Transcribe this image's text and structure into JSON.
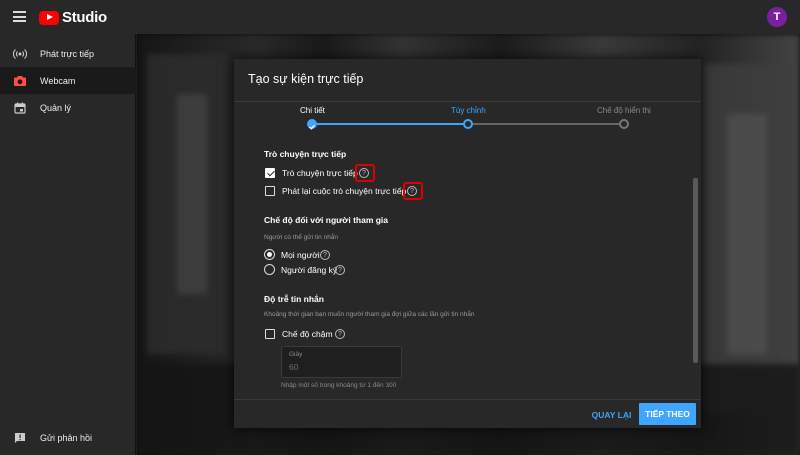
{
  "header": {
    "app_name": "Studio",
    "avatar_letter": "T"
  },
  "sidebar": {
    "items": [
      {
        "label": "Phát trực tiếp",
        "icon": "broadcast-icon"
      },
      {
        "label": "Webcam",
        "icon": "camera-icon",
        "active": true
      },
      {
        "label": "Quản lý",
        "icon": "calendar-icon"
      }
    ],
    "feedback_label": "Gửi phản hồi"
  },
  "dialog": {
    "title": "Tạo sự kiện trực tiếp",
    "steps": [
      {
        "label": "Chi tiết",
        "state": "completed"
      },
      {
        "label": "Tùy chỉnh",
        "state": "current"
      },
      {
        "label": "Chế độ hiển thị",
        "state": "pending"
      }
    ],
    "live_chat": {
      "title": "Trò chuyện trực tiếp",
      "chat_option": {
        "label": "Trò chuyện trực tiếp",
        "checked": true
      },
      "replay_option": {
        "label": "Phát lại cuộc trò chuyện trực tiếp",
        "checked": false
      }
    },
    "participant_mode": {
      "title": "Chế độ đối với người tham gia",
      "subtitle": "Người có thể gửi tin nhắn",
      "options": [
        {
          "label": "Mọi người",
          "selected": true
        },
        {
          "label": "Người đăng ký",
          "selected": false
        }
      ]
    },
    "message_delay": {
      "title": "Độ trễ tin nhắn",
      "subtitle": "Khoảng thời gian bạn muốn người tham gia đợi giữa các lần gửi tin nhắn",
      "slow_mode": {
        "label": "Chế độ chậm",
        "checked": false
      },
      "seconds_field": {
        "label": "Giây",
        "value": "60"
      },
      "hint": "Nhập một số trong khoảng từ 1 đến 300"
    },
    "buttons": {
      "back": "QUAY LẠI",
      "next": "TIẾP THEO"
    }
  },
  "colors": {
    "accent": "#3ea6ff",
    "brand": "#ff0000",
    "highlight": "#e00000",
    "avatar": "#7b1fa2"
  }
}
